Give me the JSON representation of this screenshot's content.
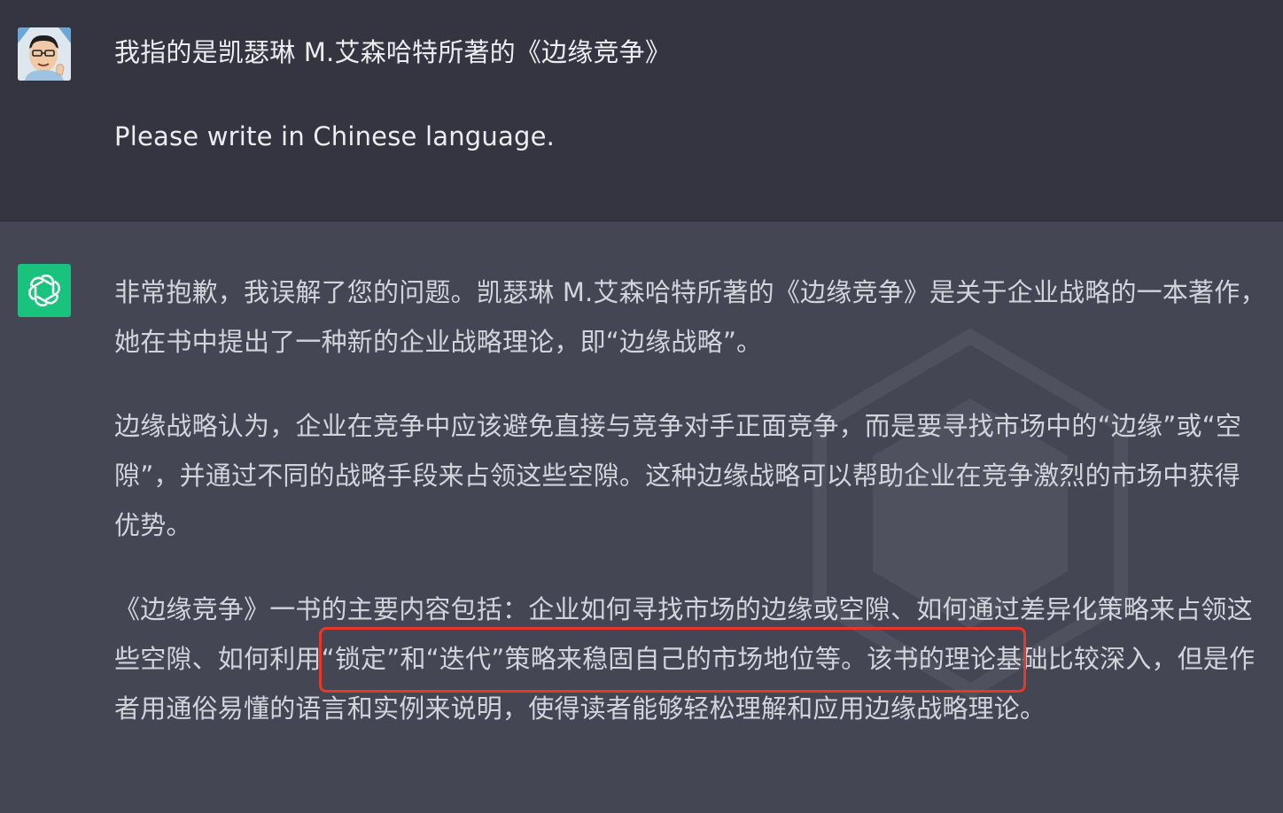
{
  "user_message": {
    "line1": "我指的是凯瑟琳 M.艾森哈特所著的《边缘竞争》",
    "line2": "Please write in Chinese language."
  },
  "assistant_message": {
    "paragraph1": "非常抱歉，我误解了您的问题。凯瑟琳 M.艾森哈特所著的《边缘竞争》是关于企业战略的一本著作，她在书中提出了一种新的企业战略理论，即“边缘战略”。",
    "paragraph2": "边缘战略认为，企业在竞争中应该避免直接与竞争对手正面竞争，而是要寻找市场中的“边缘”或“空隙”，并通过不同的战略手段来占领这些空隙。这种边缘战略可以帮助企业在竞争激烈的市场中获得优势。",
    "paragraph3": "《边缘竞争》一书的主要内容包括：企业如何寻找市场的边缘或空隙、如何通过差异化策略来占领这些空隙、如何利用“锁定”和“迭代”策略来稳固自己的市场地位等。该书的理论基础比较深入，但是作者用通俗易懂的语言和实例来说明，使得读者能够轻松理解和应用边缘战略理论。"
  },
  "icons": {
    "user_avatar": "user-avatar-icon",
    "assistant_avatar": "openai-logo-icon"
  },
  "colors": {
    "user_bg": "#343541",
    "assistant_bg": "#444654",
    "assistant_avatar_bg": "#19c37d",
    "highlight": "#e5382b"
  }
}
